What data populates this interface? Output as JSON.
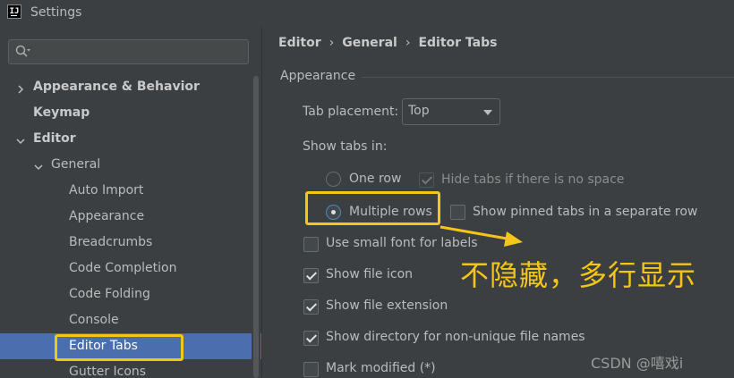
{
  "window": {
    "title": "Settings",
    "logo_text": "IJ"
  },
  "search": {
    "placeholder": "",
    "value": ""
  },
  "tree": {
    "appearance_behavior": "Appearance & Behavior",
    "keymap": "Keymap",
    "editor": "Editor",
    "general": "General",
    "auto_import": "Auto Import",
    "appearance": "Appearance",
    "breadcrumbs": "Breadcrumbs",
    "code_completion": "Code Completion",
    "code_folding": "Code Folding",
    "console": "Console",
    "editor_tabs": "Editor Tabs",
    "gutter_icons": "Gutter Icons"
  },
  "breadcrumb": {
    "level1": "Editor",
    "level2": "General",
    "level3": "Editor Tabs",
    "separator": "›"
  },
  "section": {
    "title": "Appearance"
  },
  "tab_placement": {
    "label": "Tab placement:",
    "value": "Top"
  },
  "show_tabs_in": {
    "label": "Show tabs in:"
  },
  "options": {
    "one_row": {
      "label": "One row",
      "checked": false
    },
    "hide_tabs": {
      "label": "Hide tabs if there is no space",
      "checked": true,
      "disabled": true
    },
    "multiple_rows": {
      "label": "Multiple rows",
      "checked": true
    },
    "show_pinned": {
      "label": "Show pinned tabs in a separate row",
      "checked": false
    },
    "small_font": {
      "label": "Use small font for labels",
      "checked": false
    },
    "show_file_icon": {
      "label": "Show file icon",
      "checked": true
    },
    "show_file_extension": {
      "label": "Show file extension",
      "checked": true
    },
    "show_directory": {
      "label": "Show directory for non-unique file names",
      "checked": true
    },
    "mark_modified": {
      "label": "Mark modified (*)",
      "checked": false
    }
  },
  "annotation": {
    "text": "不隐藏，多行显示"
  },
  "watermark": {
    "text": "CSDN @嘻戏i"
  },
  "colors": {
    "background": "#3c3f41",
    "selection": "#4b6eaf",
    "highlight": "#f5c518",
    "text": "#bbbbbb"
  }
}
